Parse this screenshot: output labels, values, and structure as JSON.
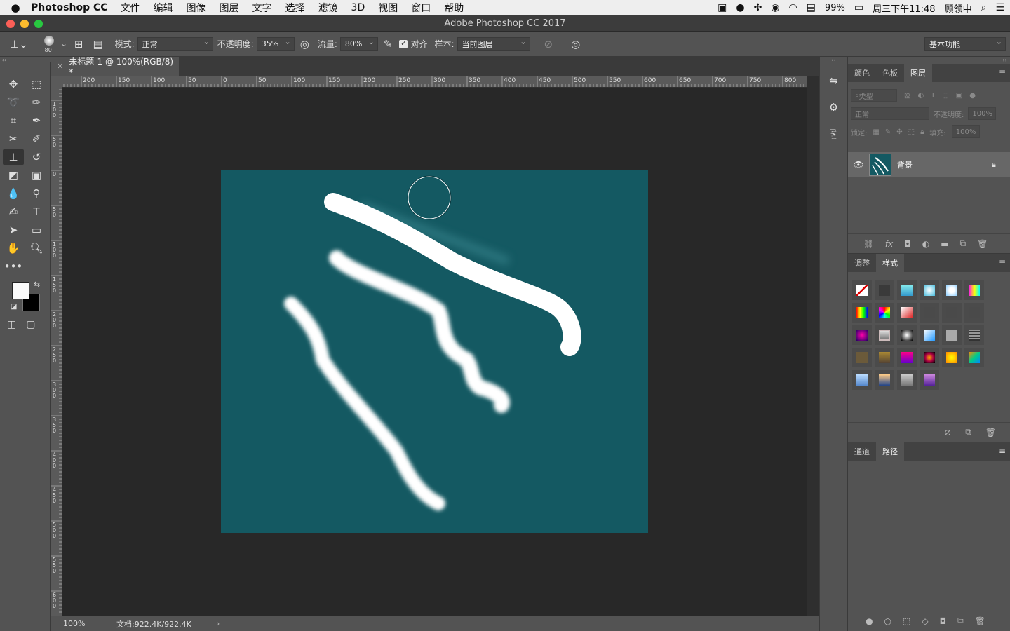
{
  "menubar": {
    "app_name": "Photoshop CC",
    "items": [
      "文件",
      "编辑",
      "图像",
      "图层",
      "文字",
      "选择",
      "滤镜",
      "3D",
      "视图",
      "窗口",
      "帮助"
    ],
    "battery": "99%",
    "clock": "周三下午11:48",
    "user": "顾领中"
  },
  "window": {
    "title": "Adobe Photoshop CC 2017"
  },
  "options": {
    "brush_size": "80",
    "mode_label": "模式:",
    "mode_value": "正常",
    "opacity_label": "不透明度:",
    "opacity_value": "35%",
    "flow_label": "流量:",
    "flow_value": "80%",
    "align_label": "对齐",
    "sample_label": "样本:",
    "sample_value": "当前图层",
    "workspace_value": "基本功能"
  },
  "document": {
    "tab_title": "未标题-1 @ 100%(RGB/8) *",
    "canvas_color": "#145962",
    "zoom": "100%",
    "doc_info": "文档:922.4K/922.4K"
  },
  "ruler": {
    "h_labels": [
      "200",
      "150",
      "100",
      "50",
      "0",
      "50",
      "100",
      "150",
      "200",
      "250",
      "300",
      "350",
      "400",
      "450",
      "500",
      "550",
      "600",
      "650",
      "700",
      "750",
      "800"
    ],
    "v_labels": [
      "100",
      "50",
      "0",
      "50",
      "100",
      "150",
      "200",
      "250",
      "300",
      "350",
      "400",
      "450",
      "500",
      "550",
      "600"
    ]
  },
  "layers_panel": {
    "tabs": [
      "颜色",
      "色板",
      "图层"
    ],
    "filter_label": "类型",
    "blend_mode": "正常",
    "opacity_label": "不透明度:",
    "opacity_value": "100%",
    "lock_label": "锁定:",
    "fill_label": "填充:",
    "fill_value": "100%",
    "layer_name": "背景"
  },
  "styles_panel": {
    "tabs": [
      "调整",
      "样式"
    ]
  },
  "paths_panel": {
    "tabs": [
      "通道",
      "路径"
    ]
  }
}
